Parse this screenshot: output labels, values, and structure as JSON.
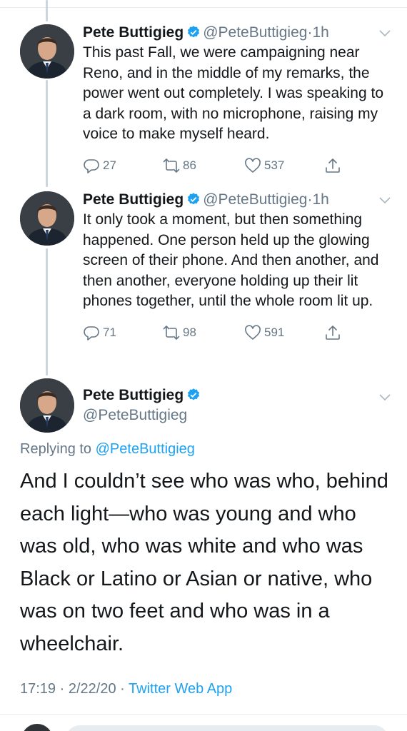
{
  "tweets": [
    {
      "display_name": "Pete Buttigieg",
      "handle": "@PeteButtigieg",
      "separator": "·",
      "time": "1h",
      "text": "This past Fall, we were campaigning near Reno, and in the middle of my remarks, the power went out completely. I was speaking to a dark room, with no microphone, raising my voice to make myself heard.",
      "replies": "27",
      "retweets": "86",
      "likes": "537"
    },
    {
      "display_name": "Pete Buttigieg",
      "handle": "@PeteButtigieg",
      "separator": "·",
      "time": "1h",
      "text": "It only took a moment, but then something happened. One person held up the glowing screen of their phone. And then another, and then another, everyone holding up their lit phones together, until the whole room lit up.",
      "replies": "71",
      "retweets": "98",
      "likes": "591"
    }
  ],
  "main_tweet": {
    "display_name": "Pete Buttigieg",
    "handle": "@PeteButtigieg",
    "replying_prefix": "Replying to",
    "replying_to": "@PeteButtigieg",
    "text": "And I couldn’t see who was who, behind each light—who was young and who was old, who was white and who was Black or Latino or Asian or native, who was on two feet and who was in a wheelchair.",
    "time": "17:19",
    "separator": "·",
    "date": "2/22/20",
    "source": "Twitter Web App"
  },
  "icons": {
    "verified": "verified-badge-icon",
    "chevron": "chevron-down-icon",
    "reply": "reply-icon",
    "retweet": "retweet-icon",
    "like": "heart-icon",
    "share": "share-icon"
  },
  "colors": {
    "accent": "#1da1f2",
    "secondary_text": "#657786",
    "divider": "#e6ecf0",
    "thread_line": "#ccd6dd"
  }
}
